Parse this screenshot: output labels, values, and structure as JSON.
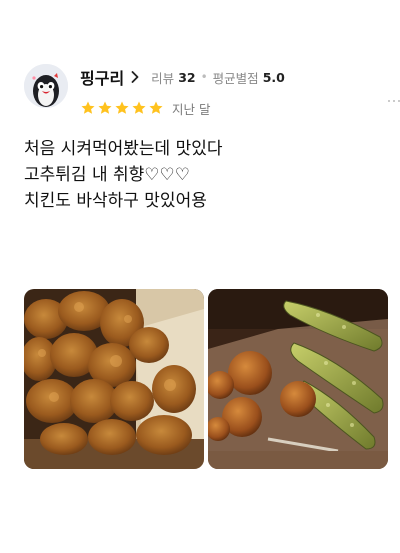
{
  "reviewer": {
    "name": "핑구리",
    "review_label": "리뷰",
    "review_count": "32",
    "avg_label": "평균별점",
    "avg_score": "5.0"
  },
  "rating": {
    "stars": 5,
    "max": 5,
    "star_color": "#FFC21E"
  },
  "review": {
    "date": "지난 달",
    "lines": [
      "처음 시켜먹어봤는데 맛있다",
      "고추튀김 내 취향♡♡♡",
      "치킨도 바삭하구 맛있어용"
    ]
  },
  "photos": [
    {
      "icon": "fried-chicken-photo"
    },
    {
      "icon": "fried-pepper-and-balls-photo"
    }
  ]
}
